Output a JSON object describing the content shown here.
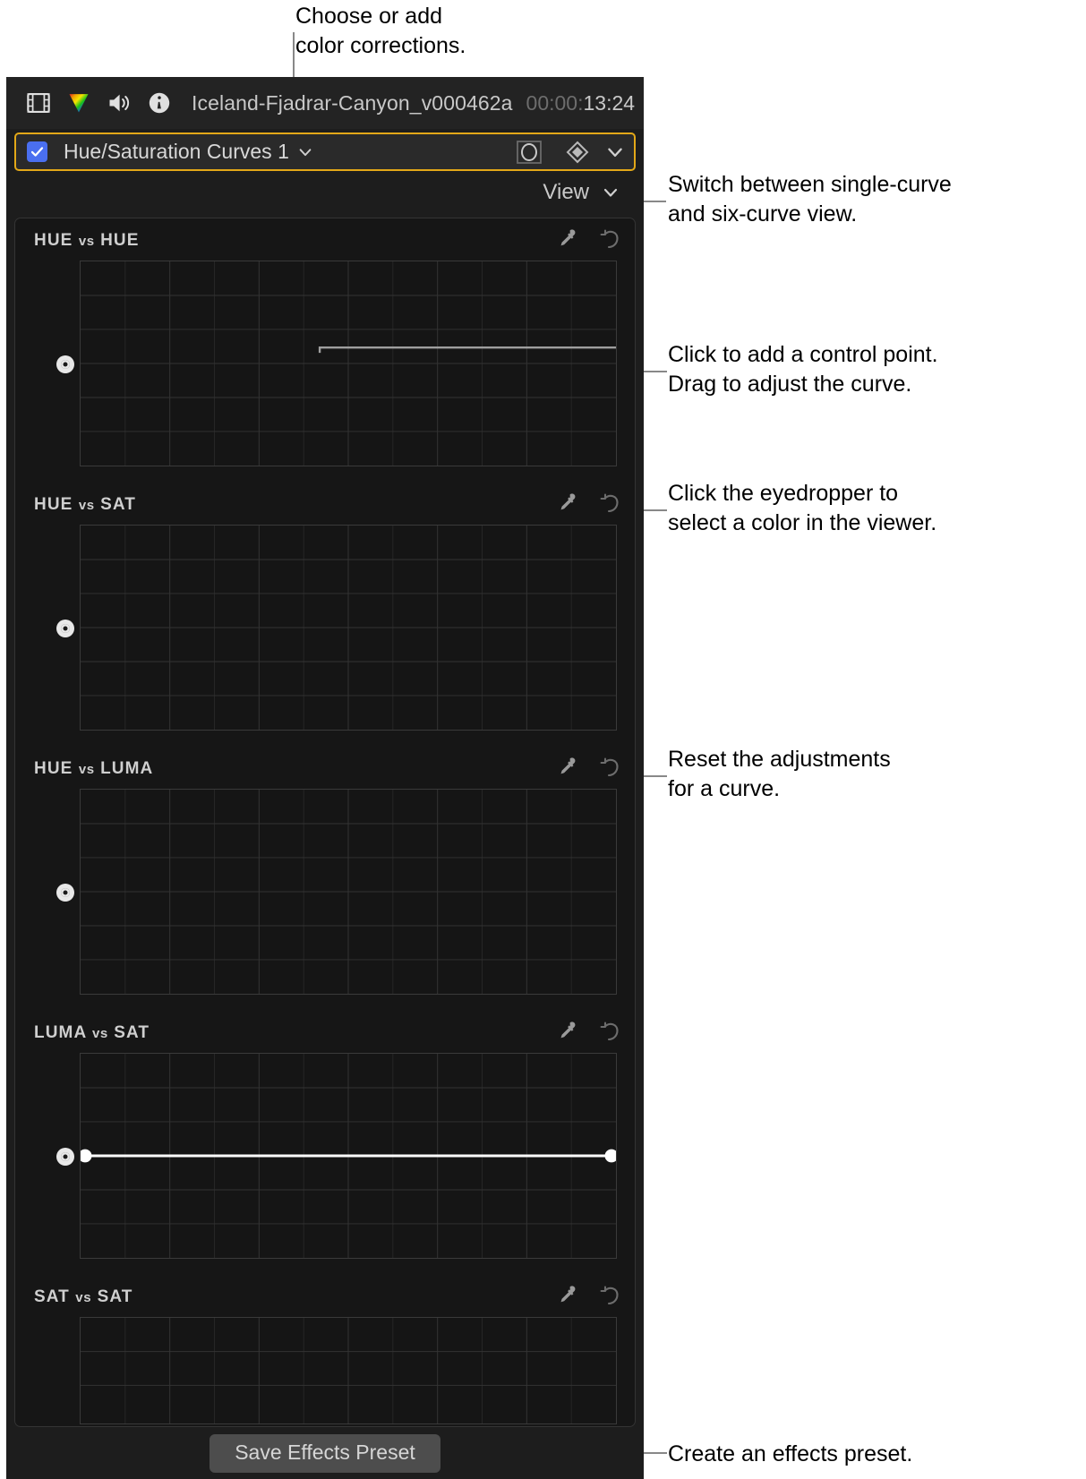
{
  "window": {
    "clip_name": "Iceland-Fjadrar-Canyon_v000462a",
    "timecode_dim": "00:00:",
    "timecode_bright": "13:24",
    "icons": [
      "film-strip-icon",
      "color-wheel-icon",
      "audio-speaker-icon",
      "info-icon"
    ]
  },
  "effect": {
    "checkbox_checked": true,
    "name": "Hue/Saturation Curves 1",
    "dropdown_icon": "chevron-down-icon",
    "mask_icon": "shape-mask-icon",
    "keyframe_icon": "keyframe-diamond-icon",
    "menu_icon": "chevron-down-icon",
    "accent_color": "#e3a818"
  },
  "view": {
    "label": "View",
    "chevron_icon": "chevron-down-icon"
  },
  "curves": [
    {
      "title_main": "HUE",
      "title_vs": "vs",
      "title_second": "HUE",
      "full_title": "HUE vs HUE",
      "eyedropper_icon": "eyedropper-icon",
      "reset_icon": "reset-arrow-icon",
      "radio_selected": true,
      "spectrum": true,
      "control_curve": "step",
      "control_points": []
    },
    {
      "title_main": "HUE",
      "title_vs": "vs",
      "title_second": "SAT",
      "full_title": "HUE vs SAT",
      "eyedropper_icon": "eyedropper-icon",
      "reset_icon": "reset-arrow-icon",
      "radio_selected": true,
      "spectrum": true,
      "control_curve": "flat",
      "control_points": []
    },
    {
      "title_main": "HUE",
      "title_vs": "vs",
      "title_second": "LUMA",
      "full_title": "HUE vs LUMA",
      "eyedropper_icon": "eyedropper-icon",
      "reset_icon": "reset-arrow-icon",
      "radio_selected": true,
      "spectrum": true,
      "control_curve": "flat",
      "control_points": []
    },
    {
      "title_main": "LUMA",
      "title_vs": "vs",
      "title_second": "SAT",
      "full_title": "LUMA vs SAT",
      "eyedropper_icon": "eyedropper-icon",
      "reset_icon": "reset-arrow-icon",
      "radio_selected": true,
      "spectrum": false,
      "control_curve": "white-line",
      "control_points": [
        "left-endpoint",
        "right-endpoint"
      ]
    },
    {
      "title_main": "SAT",
      "title_vs": "vs",
      "title_second": "SAT",
      "full_title": "SAT vs SAT",
      "eyedropper_icon": "eyedropper-icon",
      "reset_icon": "reset-arrow-icon",
      "radio_selected": false,
      "spectrum": false,
      "control_curve": "none",
      "control_points": []
    }
  ],
  "footer": {
    "save_preset_label": "Save Effects Preset"
  },
  "annotations": [
    {
      "id": "choose-add",
      "text": "Choose or add\ncolor corrections."
    },
    {
      "id": "switch-view",
      "text": "Switch between single-curve\nand six-curve view."
    },
    {
      "id": "add-control-point",
      "text": "Click to add a control point.\nDrag to adjust the curve."
    },
    {
      "id": "eyedropper",
      "text": "Click the eyedropper to\nselect a color in the viewer."
    },
    {
      "id": "reset",
      "text": "Reset the adjustments\nfor a curve."
    },
    {
      "id": "create-preset",
      "text": "Create an effects preset."
    }
  ]
}
